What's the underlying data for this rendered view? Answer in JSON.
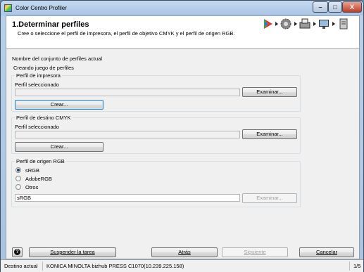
{
  "window": {
    "title": "Color Centro Profiler",
    "minimize": "–",
    "maximize": "□",
    "close": "X"
  },
  "header": {
    "title": "1.Determinar perfiles",
    "subtitle": "Cree o seleccione el perfil de impresora, el perfil de objetivo CMYK y el perfil de origen RGB.",
    "steps": [
      "wand-icon",
      "gear-icon",
      "printer-icon",
      "monitor-icon",
      "document-icon"
    ]
  },
  "profile_set": {
    "label": "Nombre del conjunto de perfiles actual",
    "value": "Creando juego de perfiles"
  },
  "printer_profile": {
    "group_title": "Perfil de impresora",
    "selected_label": "Perfil seleccionado",
    "selected_value": "",
    "browse": "Examinar...",
    "create": "Crear..."
  },
  "cmyk_profile": {
    "group_title": "Perfil de destino CMYK",
    "selected_label": "Perfil seleccionado",
    "selected_value": "",
    "browse": "Examinar...",
    "create": "Crear..."
  },
  "rgb_profile": {
    "group_title": "Perfil de origen RGB",
    "options": [
      "sRGB",
      "AdobeRGB",
      "Otros"
    ],
    "selected": "sRGB",
    "field_value": "sRGB",
    "browse": "Examinar..."
  },
  "footer": {
    "help": "?",
    "suspend": "Suspender la tarea",
    "back": "Atrás",
    "next": "Siguiente",
    "cancel": "Cancelar"
  },
  "status": {
    "destination_label": "Destino actual",
    "destination_value": "KONICA MINOLTA bizhub PRESS C1070(10.239.225.158)",
    "page": "1/5"
  },
  "colors": {
    "titlebar": "#b9d1ea",
    "panel": "#f0f0f0",
    "accent": "#3c7fb1"
  }
}
